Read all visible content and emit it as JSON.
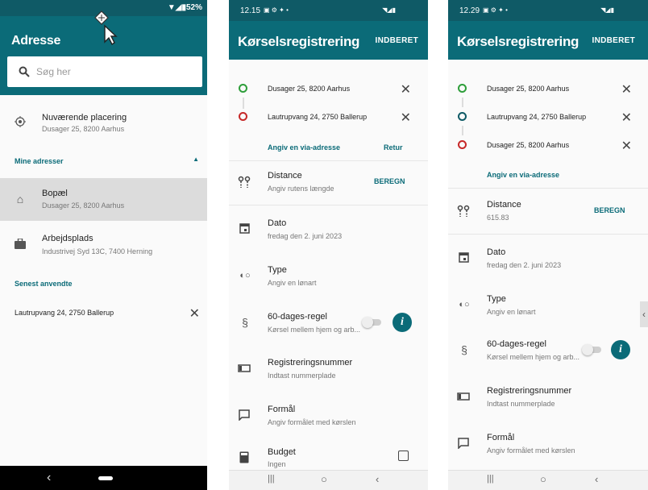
{
  "screen1": {
    "status_icons": "▼◢▮52%",
    "title": "Adresse",
    "search_placeholder": "Søg her",
    "current_location": {
      "label": "Nuværende placering",
      "address": "Dusager 25, 8200 Aarhus"
    },
    "my_addresses_header": "Mine adresser",
    "home": {
      "label": "Bopæl",
      "address": "Dusager 25, 8200 Aarhus"
    },
    "work": {
      "label": "Arbejdsplads",
      "address": "Industrivej Syd 13C, 7400 Herning"
    },
    "recent_header": "Senest anvendte",
    "recent_items": [
      {
        "address": "Lautrupvang 24, 2750 Ballerup"
      }
    ],
    "nav_back": "‹"
  },
  "screen2": {
    "status_time": "12.15",
    "status_icons_left": "▣ ⚙ ✦ •",
    "status_icons_right": "◥◢▮",
    "title": "Kørselsregistrering",
    "action": "INDBERET",
    "route": [
      {
        "address": "Dusager 25, 8200 Aarhus",
        "color": "#2e9e3a"
      },
      {
        "address": "Lautrupvang 24, 2750 Ballerup",
        "color": "#c62828"
      }
    ],
    "via_link": "Angiv en via-adresse",
    "return_link": "Retur",
    "distance": {
      "label": "Distance",
      "sub": "Angiv rutens længde",
      "action": "BEREGN"
    },
    "date": {
      "label": "Dato",
      "sub": "fredag den 2. juni 2023"
    },
    "type": {
      "label": "Type",
      "sub": "Angiv en lønart"
    },
    "rule60": {
      "label": "60-dages-regel",
      "sub": "Kørsel mellem hjem og arb..."
    },
    "registration": {
      "label": "Registreringsnummer",
      "sub": "Indtast nummerplade"
    },
    "purpose": {
      "label": "Formål",
      "sub": "Angiv formålet med kørslen"
    },
    "budget": {
      "label": "Budget",
      "sub": "Ingen"
    }
  },
  "screen3": {
    "status_time": "12.29",
    "status_icons_left": "▣ ⚙ ✦ •",
    "status_icons_right": "◥◢▮",
    "title": "Kørselsregistrering",
    "action": "INDBERET",
    "route": [
      {
        "address": "Dusager 25, 8200 Aarhus",
        "color": "#2e9e3a"
      },
      {
        "address": "Lautrupvang 24, 2750 Ballerup",
        "color": "#0f5a66"
      },
      {
        "address": "Dusager 25, 8200 Aarhus",
        "color": "#c62828"
      }
    ],
    "via_link": "Angiv en via-adresse",
    "distance": {
      "label": "Distance",
      "sub": "615.83",
      "action": "BEREGN"
    },
    "date": {
      "label": "Dato",
      "sub": "fredag den 2. juni 2023"
    },
    "type": {
      "label": "Type",
      "sub": "Angiv en lønart"
    },
    "rule60": {
      "label": "60-dages-regel",
      "sub": "Kørsel mellem hjem og arb..."
    },
    "registration": {
      "label": "Registreringsnummer",
      "sub": "Indtast nummerplade"
    },
    "purpose": {
      "label": "Formål",
      "sub": "Angiv formålet med kørslen"
    }
  },
  "icons": {
    "location": "location-target-icon",
    "home": "home-icon",
    "work": "briefcase-icon",
    "distance": "distance-icon",
    "calendar": "calendar-icon",
    "type": "type-icon",
    "paragraph": "paragraph-icon",
    "plate": "license-plate-icon",
    "comment": "comment-icon",
    "budget": "calculator-icon"
  },
  "colors": {
    "primary": "#0b6b78",
    "statusbar": "#0f5a66",
    "start": "#2e9e3a",
    "end": "#c62828"
  }
}
